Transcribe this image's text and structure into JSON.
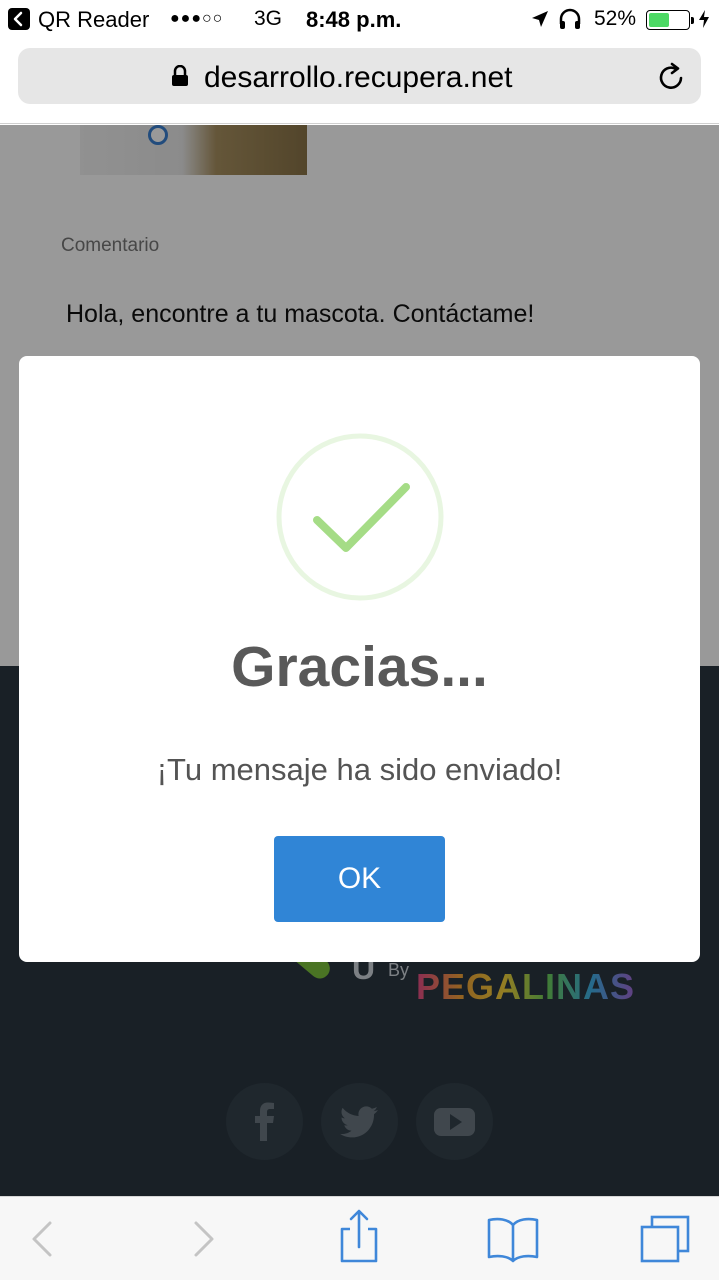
{
  "status_bar": {
    "back_app": "QR Reader",
    "signal": "●●●○○",
    "network": "3G",
    "time": "8:48 p.m.",
    "battery": "52%",
    "battery_level": 0.52
  },
  "address_bar": {
    "url": "desarrollo.recupera.net"
  },
  "page": {
    "comment_label": "Comentario",
    "comment_text": "Hola, encontre a tu mascota. Contáctame!",
    "footer": {
      "logo_letter": "U",
      "by": "By",
      "brand": "PEGALINAS",
      "social": [
        "facebook-icon",
        "twitter-icon",
        "youtube-icon"
      ]
    }
  },
  "modal": {
    "icon": "success-check-icon",
    "title": "Gracias...",
    "message": "¡Tu mensaje ha sido enviado!",
    "ok_label": "OK",
    "accent": "#3085d6",
    "check_color": "#a5dc86"
  },
  "toolbar": {
    "items": [
      "back-icon",
      "forward-icon",
      "share-icon",
      "bookmarks-icon",
      "tabs-icon"
    ]
  }
}
